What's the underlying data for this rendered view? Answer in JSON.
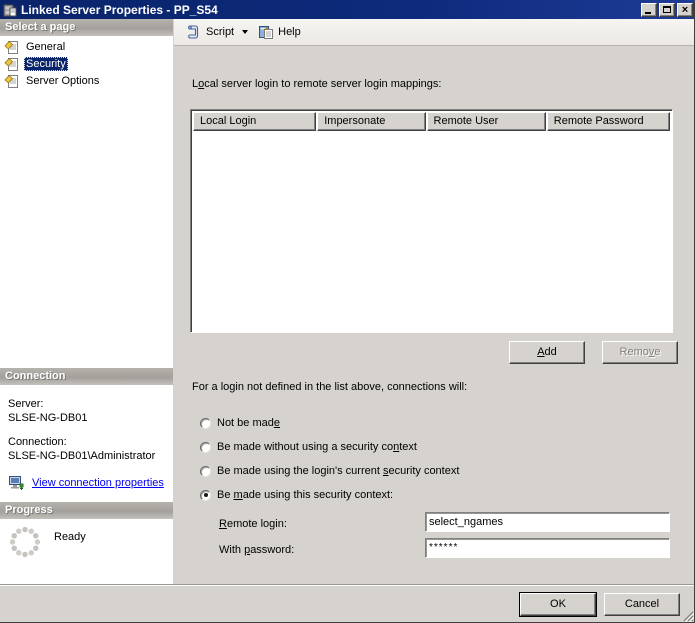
{
  "window": {
    "title": "Linked Server Properties - PP_S54"
  },
  "sidebar": {
    "select_page": {
      "header": "Select a page",
      "items": [
        {
          "label": "General",
          "selected": false
        },
        {
          "label": "Security",
          "selected": true
        },
        {
          "label": "Server Options",
          "selected": false
        }
      ]
    },
    "connection": {
      "header": "Connection",
      "server_label": "Server:",
      "server_value": "SLSE-NG-DB01",
      "connection_label": "Connection:",
      "connection_value": "SLSE-NG-DB01\\Administrator",
      "link_label": "View connection properties"
    },
    "progress": {
      "header": "Progress",
      "status": "Ready"
    }
  },
  "toolbar": {
    "script_label": "Script",
    "help_label": "Help"
  },
  "main": {
    "mappings_label": {
      "pre": "L",
      "u": "o",
      "post": "cal server login to remote server login mappings:"
    },
    "table": {
      "columns": [
        "Local Login",
        "Impersonate",
        "Remote User",
        "Remote Password"
      ],
      "rows": []
    },
    "add_button": {
      "pre": "",
      "u": "A",
      "post": "dd"
    },
    "remove_button": {
      "pre": "Remo",
      "u": "v",
      "post": "e"
    },
    "fallback_label": "For a login not defined in the list above, connections will:",
    "radios": [
      {
        "pre": "Not be mad",
        "u": "e",
        "post": "",
        "selected": false
      },
      {
        "pre": "Be made without using a security co",
        "u": "n",
        "post": "text",
        "selected": false
      },
      {
        "pre": "Be made using the login's current ",
        "u": "s",
        "post": "ecurity context",
        "selected": false
      },
      {
        "pre": "Be ",
        "u": "m",
        "post": "ade using this security context:",
        "selected": true
      }
    ],
    "remote_login": {
      "pre": "",
      "u": "R",
      "post": "emote login:",
      "value": "select_ngames"
    },
    "with_password": {
      "pre": "With ",
      "u": "p",
      "post": "assword:",
      "value": "******"
    }
  },
  "footer": {
    "ok_label": "OK",
    "cancel_label": "Cancel"
  },
  "colors": {
    "titlebar": "#0a246a",
    "selection": "#0a246a",
    "panel": "#d6d3ce",
    "link": "#0000ee",
    "disabled_text": "#817f7a"
  }
}
